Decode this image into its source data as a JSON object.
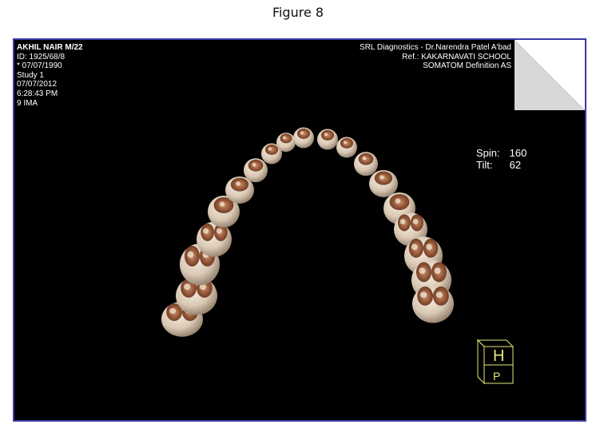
{
  "figure": {
    "caption": "Figure 8"
  },
  "overlay_left": {
    "patient_name": "AKHIL  NAIR M/22",
    "id": "ID: 1925/68/8",
    "dob": "* 07/07/1990",
    "study": "Study 1",
    "date": "07/07/2012",
    "time": "6:28:43 PM",
    "images": "9 IMA"
  },
  "overlay_right": {
    "institution": "SRL Diagnostics - Dr.Narendra Patel A'bad",
    "referral": "Ref.: KAKARNAVATI SCHOOL",
    "scanner": "SOMATOM Definition AS"
  },
  "view_params": {
    "spin_label": "Spin:",
    "spin_value": "160",
    "tilt_label": "Tilt:",
    "tilt_value": "62"
  },
  "orientation_cube": {
    "top_letter": "H",
    "front_letter": "P",
    "color": "#e6e67a"
  },
  "colors": {
    "background": "#000000",
    "frame_border": "#3a3aa8",
    "corner_triangle": "#d8d8d8",
    "tooth_enamel": "#e8dccb",
    "tooth_stain": "#7a3a1e"
  }
}
